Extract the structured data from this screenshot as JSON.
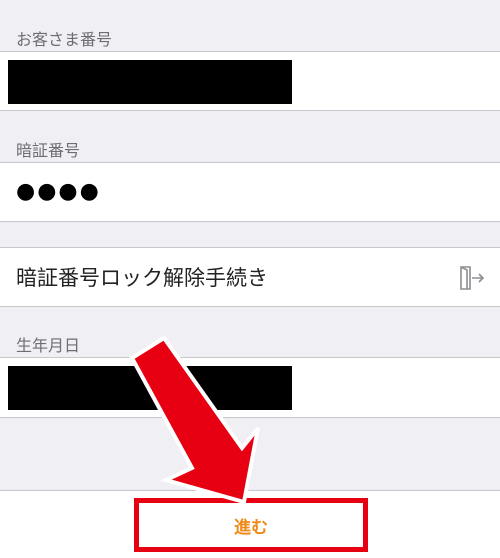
{
  "form": {
    "customer_number_label": "お客さま番号",
    "pin_label": "暗証番号",
    "pin_value": "●●●●",
    "pin_lock_release_label": "暗証番号ロック解除手続き",
    "birthdate_label": "生年月日",
    "next_button_label": "進む"
  },
  "colors": {
    "highlight_red": "#e60012",
    "button_text_orange": "#f08a18",
    "background_gray": "#efeff4"
  },
  "icons": {
    "pin_lock_release": "exit-door-icon",
    "annotation": "red-arrow"
  }
}
